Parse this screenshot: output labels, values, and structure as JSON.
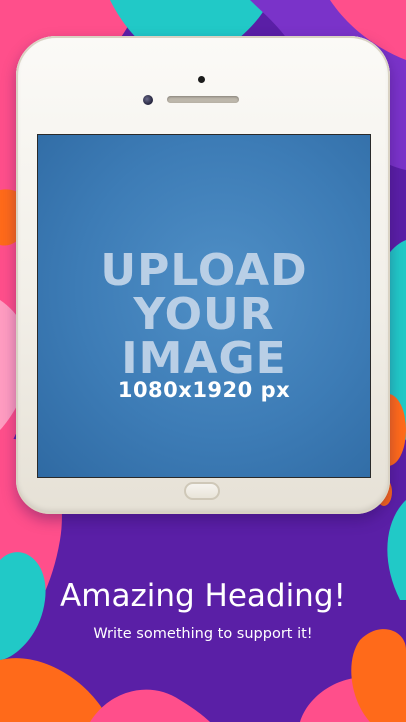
{
  "mockup": {
    "screen_placeholder": {
      "line1": "UPLOAD",
      "line2": "YOUR",
      "line3": "IMAGE",
      "dimensions": "1080x1920 px"
    }
  },
  "caption": {
    "heading": "Amazing Heading!",
    "subheading": "Write something to support it!"
  },
  "colors": {
    "background_purple": "#5a1fa6",
    "pink": "#ff4f8b",
    "teal": "#21c9c7",
    "orange": "#ff6a1a",
    "screen_blue": "#3d7cb6",
    "phone_body": "#f4f1ea"
  },
  "icons": [
    "camera-icon",
    "front-camera-icon",
    "speaker-grille-icon",
    "home-button-icon"
  ]
}
